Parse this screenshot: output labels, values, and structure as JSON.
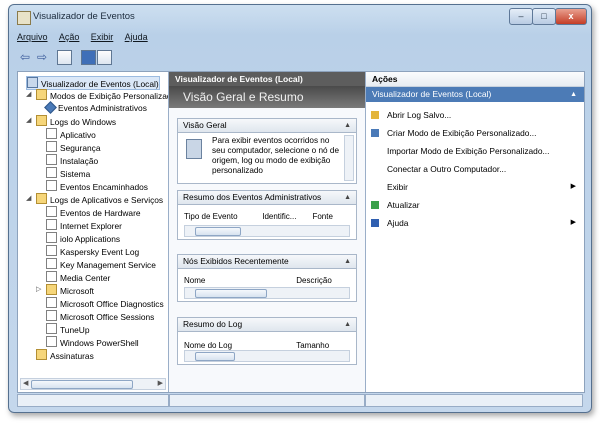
{
  "window": {
    "title": "Visualizador de Eventos",
    "controls": {
      "minimize": "–",
      "maximize": "□",
      "close": "x"
    }
  },
  "menu": [
    "Arquivo",
    "Ação",
    "Exibir",
    "Ajuda"
  ],
  "tree": {
    "items": [
      {
        "label": "Visualizador de Eventos (Local)",
        "depth": 0,
        "icon": "viewer",
        "selected": true
      },
      {
        "label": "Modos de Exibição Personalizados",
        "depth": 1,
        "icon": "folder",
        "expander": "◢"
      },
      {
        "label": "Eventos Administrativos",
        "depth": 2,
        "icon": "filter"
      },
      {
        "label": "Logs do Windows",
        "depth": 1,
        "icon": "folder",
        "expander": "◢"
      },
      {
        "label": "Aplicativo",
        "depth": 2,
        "icon": "log"
      },
      {
        "label": "Segurança",
        "depth": 2,
        "icon": "log"
      },
      {
        "label": "Instalação",
        "depth": 2,
        "icon": "log"
      },
      {
        "label": "Sistema",
        "depth": 2,
        "icon": "log"
      },
      {
        "label": "Eventos Encaminhados",
        "depth": 2,
        "icon": "log"
      },
      {
        "label": "Logs de Aplicativos e Serviços",
        "depth": 1,
        "icon": "folder",
        "expander": "◢"
      },
      {
        "label": "Eventos de Hardware",
        "depth": 2,
        "icon": "log"
      },
      {
        "label": "Internet Explorer",
        "depth": 2,
        "icon": "log"
      },
      {
        "label": "iolo Applications",
        "depth": 2,
        "icon": "log"
      },
      {
        "label": "Kaspersky Event Log",
        "depth": 2,
        "icon": "log"
      },
      {
        "label": "Key Management Service",
        "depth": 2,
        "icon": "log"
      },
      {
        "label": "Media Center",
        "depth": 2,
        "icon": "log"
      },
      {
        "label": "Microsoft",
        "depth": 2,
        "icon": "folder",
        "expander": "▷"
      },
      {
        "label": "Microsoft Office Diagnostics",
        "depth": 2,
        "icon": "log"
      },
      {
        "label": "Microsoft Office Sessions",
        "depth": 2,
        "icon": "log"
      },
      {
        "label": "TuneUp",
        "depth": 2,
        "icon": "log"
      },
      {
        "label": "Windows PowerShell",
        "depth": 2,
        "icon": "log"
      },
      {
        "label": "Assinaturas",
        "depth": 1,
        "icon": "folder"
      }
    ]
  },
  "middle": {
    "header": "Visualizador de Eventos (Local)",
    "banner": "Visão Geral e Resumo",
    "overview": {
      "title": "Visão Geral",
      "text": "Para exibir eventos ocorridos no seu computador, selecione o nó de origem, log ou modo de exibição personalizado"
    },
    "admin_summary": {
      "title": "Resumo dos Eventos Administrativos",
      "columns": [
        "Tipo de Evento",
        "Identific...",
        "Fonte"
      ]
    },
    "recent": {
      "title": "Nós Exibidos Recentemente",
      "columns": [
        "Nome",
        "Descrição"
      ]
    },
    "log_summary": {
      "title": "Resumo do Log",
      "columns": [
        "Nome do Log",
        "Tamanho"
      ]
    }
  },
  "actions": {
    "header": "Ações",
    "section": "Visualizador de Eventos (Local)",
    "items": [
      {
        "label": "Abrir Log Salvo...",
        "icon": "folder-open"
      },
      {
        "label": "Criar Modo de Exibição Personalizado...",
        "icon": "filter"
      },
      {
        "label": "Importar Modo de Exibição Personalizado...",
        "icon": ""
      },
      {
        "label": "Conectar a Outro Computador...",
        "icon": ""
      },
      {
        "label": "Exibir",
        "icon": "",
        "submenu": true
      },
      {
        "label": "Atualizar",
        "icon": "refresh"
      },
      {
        "label": "Ajuda",
        "icon": "help",
        "submenu": true
      }
    ]
  },
  "colors": {
    "accent": "#4c7bb6",
    "frame": "#b9d0e8",
    "mid_header": "#5d5d5d"
  }
}
